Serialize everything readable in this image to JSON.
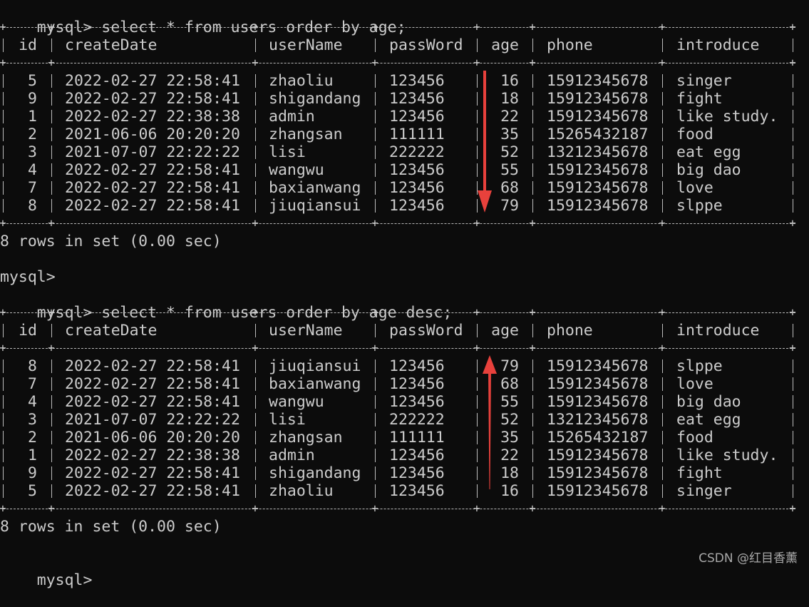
{
  "terminal": {
    "prompt": "mysql>",
    "query1": "select * from users order by age;",
    "query2": "select * from users order by age desc;",
    "summary1": "8 rows in set (0.00 sec)",
    "summary2": "8 rows in set (0.00 sec)",
    "columns": [
      "id",
      "createDate",
      "userName",
      "passWord",
      "age",
      "phone",
      "introduce"
    ],
    "rows_asc": [
      [
        "5",
        "2022-02-27 22:58:41",
        "zhaoliu",
        "123456",
        "16",
        "15912345678",
        "singer"
      ],
      [
        "9",
        "2022-02-27 22:58:41",
        "shigandang",
        "123456",
        "18",
        "15912345678",
        "fight"
      ],
      [
        "1",
        "2022-02-27 22:38:38",
        "admin",
        "123456",
        "22",
        "15912345678",
        "like study."
      ],
      [
        "2",
        "2021-06-06 20:20:20",
        "zhangsan",
        "111111",
        "35",
        "15265432187",
        "food"
      ],
      [
        "3",
        "2021-07-07 22:22:22",
        "lisi",
        "222222",
        "52",
        "13212345678",
        "eat egg"
      ],
      [
        "4",
        "2022-02-27 22:58:41",
        "wangwu",
        "123456",
        "55",
        "15912345678",
        "big dao"
      ],
      [
        "7",
        "2022-02-27 22:58:41",
        "baxianwang",
        "123456",
        "68",
        "15912345678",
        "love"
      ],
      [
        "8",
        "2022-02-27 22:58:41",
        "jiuqiansui",
        "123456",
        "79",
        "15912345678",
        "slppe"
      ]
    ],
    "rows_desc": [
      [
        "8",
        "2022-02-27 22:58:41",
        "jiuqiansui",
        "123456",
        "79",
        "15912345678",
        "slppe"
      ],
      [
        "7",
        "2022-02-27 22:58:41",
        "baxianwang",
        "123456",
        "68",
        "15912345678",
        "love"
      ],
      [
        "4",
        "2022-02-27 22:58:41",
        "wangwu",
        "123456",
        "55",
        "15912345678",
        "big dao"
      ],
      [
        "3",
        "2021-07-07 22:22:22",
        "lisi",
        "222222",
        "52",
        "13212345678",
        "eat egg"
      ],
      [
        "2",
        "2021-06-06 20:20:20",
        "zhangsan",
        "111111",
        "35",
        "15265432187",
        "food"
      ],
      [
        "1",
        "2022-02-27 22:38:38",
        "admin",
        "123456",
        "22",
        "15912345678",
        "like study."
      ],
      [
        "9",
        "2022-02-27 22:58:41",
        "shigandang",
        "123456",
        "18",
        "15912345678",
        "fight"
      ],
      [
        "5",
        "2022-02-27 22:58:41",
        "zhaoliu",
        "123456",
        "16",
        "15912345678",
        "singer"
      ]
    ]
  },
  "annotations": {
    "arrow_color": "#e8413c",
    "arrow1_direction": "down",
    "arrow2_direction": "up"
  },
  "watermark": "CSDN @红目香薰",
  "colors": {
    "background": "#0c0c0c",
    "text": "#cccccc"
  }
}
